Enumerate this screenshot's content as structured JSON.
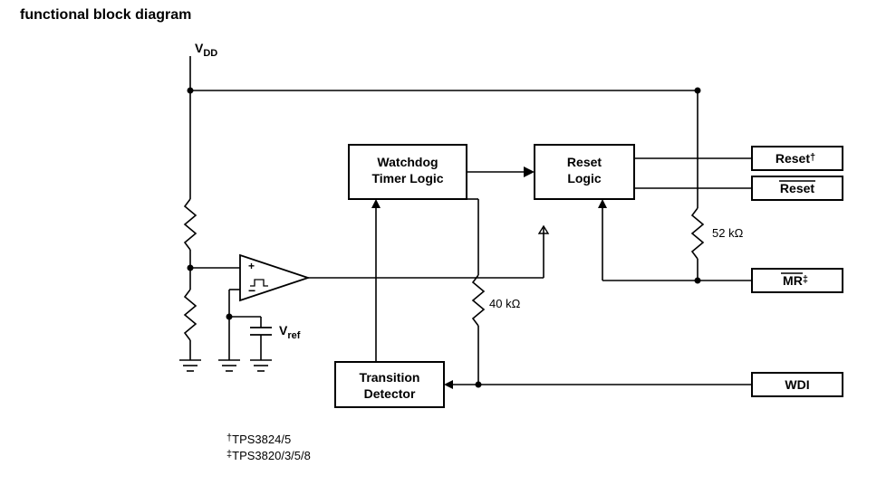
{
  "title": "functional block diagram",
  "vdd": "V",
  "vdd_sub": "DD",
  "vref": "V",
  "vref_sub": "ref",
  "blocks": {
    "watchdog_l1": "Watchdog",
    "watchdog_l2": "Timer Logic",
    "reset_l1": "Reset",
    "reset_l2": "Logic",
    "transition_l1": "Transition",
    "transition_l2": "Detector"
  },
  "pins": {
    "reset_high": "Reset",
    "reset_high_dag": "†",
    "reset_bar": "Reset",
    "mr_bar": "MR",
    "mr_dag": "‡",
    "wdi": "WDI"
  },
  "values": {
    "r52k": "52 kΩ",
    "r40k": "40 kΩ"
  },
  "notes": {
    "n1_dag": "†",
    "n1_txt": "TPS3824/5",
    "n2_dag": "‡",
    "n2_txt": "TPS3820/3/5/8"
  }
}
